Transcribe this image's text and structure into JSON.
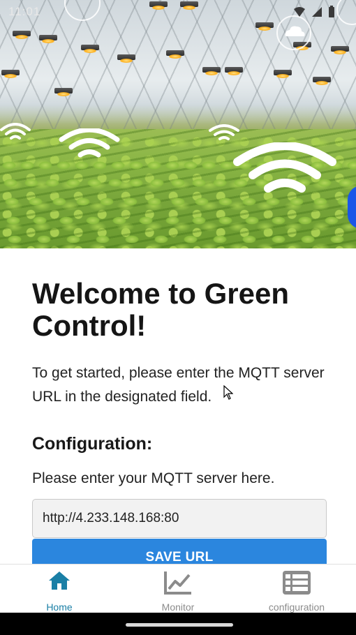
{
  "status_bar": {
    "time": "11:01"
  },
  "main": {
    "title": "Welcome to Green Control!",
    "intro": "To get started, please enter the MQTT server URL in the designated field.",
    "config": {
      "heading": "Configuration:",
      "description": "Please enter your MQTT server here.",
      "url_value": "http://4.233.148.168:80",
      "save_label": "SAVE URL"
    }
  },
  "bottom_nav": {
    "items": [
      {
        "label": "Home",
        "icon": "home-icon",
        "active": true
      },
      {
        "label": "Monitor",
        "icon": "chart-line-icon",
        "active": false
      },
      {
        "label": "configuration",
        "icon": "table-list-icon",
        "active": false
      }
    ]
  },
  "colors": {
    "primary_button": "#2b86de",
    "nav_active": "#1a7fa6",
    "nav_inactive": "#8b8b8b",
    "fab": "#1a56e8"
  }
}
